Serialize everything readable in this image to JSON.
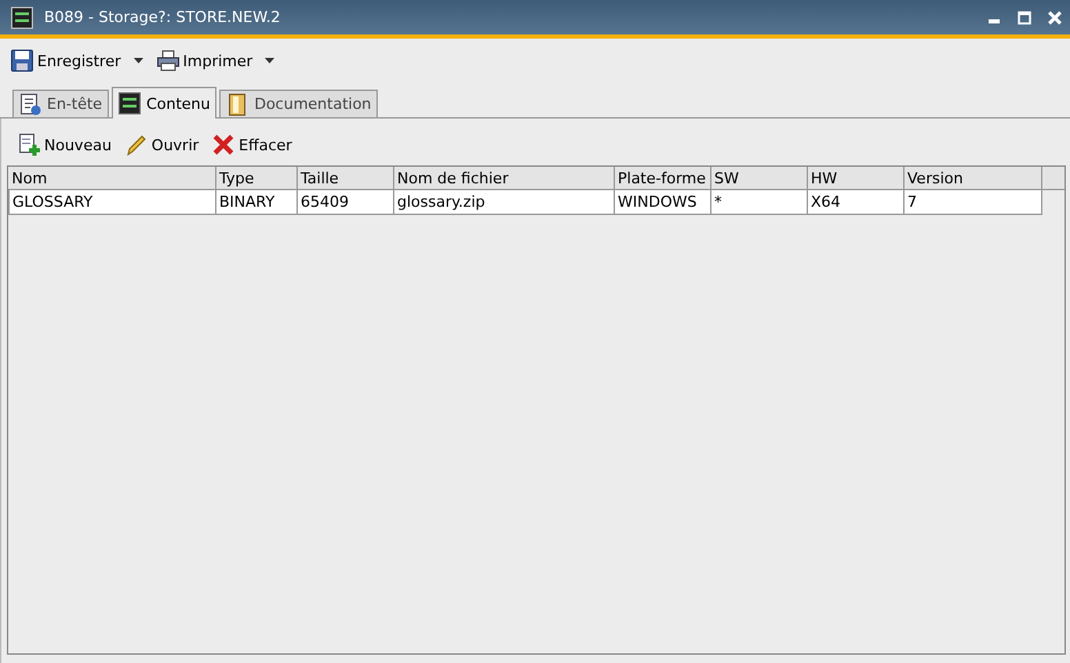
{
  "window": {
    "title": "B089 - Storage?: STORE.NEW.2"
  },
  "toolbar": [
    {
      "label": "Enregistrer",
      "kind": "save"
    },
    {
      "label": "Imprimer",
      "kind": "print"
    }
  ],
  "tabs": [
    {
      "label": "En-tête",
      "kind": "header",
      "selected": false
    },
    {
      "label": "Contenu",
      "kind": "content",
      "selected": true
    },
    {
      "label": "Documentation",
      "kind": "doc",
      "selected": false
    }
  ],
  "actions": [
    {
      "label": "Nouveau",
      "kind": "new"
    },
    {
      "label": "Ouvrir",
      "kind": "open"
    },
    {
      "label": "Effacer",
      "kind": "delete"
    }
  ],
  "table": {
    "columns": [
      "Nom",
      "Type",
      "Taille",
      "Nom de fichier",
      "Plate-forme",
      "SW",
      "HW",
      "Version"
    ],
    "rows": [
      [
        "GLOSSARY",
        "BINARY",
        "65409",
        "glossary.zip",
        "WINDOWS",
        "*",
        "X64",
        "7"
      ]
    ]
  }
}
